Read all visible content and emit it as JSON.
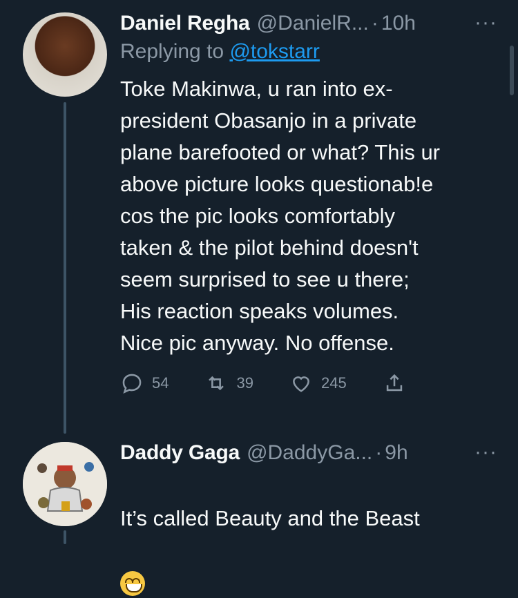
{
  "tweets": [
    {
      "name": "Daniel Regha",
      "handle": "@DanielR...",
      "separator": "·",
      "time": "10h",
      "more": "···",
      "replying_label": "Replying to",
      "replying_handle": "@tokstarr",
      "text": "Toke Makinwa, u ran into ex-\npresident Obasanjo in a private\nplane barefooted or what? This ur\nabove picture looks questionab!e\ncos the pic looks comfortably\ntaken & the pilot behind doesn't\nseem surprised to see u there;\nHis reaction speaks volumes.\nNice pic anyway. No offense.",
      "replies": "54",
      "retweets": "39",
      "likes": "245"
    },
    {
      "name": "Daddy Gaga",
      "handle": "@DaddyGa...",
      "separator": "·",
      "time": "9h",
      "more": "···",
      "text": "It’s called Beauty and the Beast",
      "emoji": "grinning-face-emoji"
    }
  ],
  "colors": {
    "background": "#15202b",
    "text": "#f7f9f9",
    "muted": "#8b98a5",
    "link": "#1d9bf0"
  }
}
